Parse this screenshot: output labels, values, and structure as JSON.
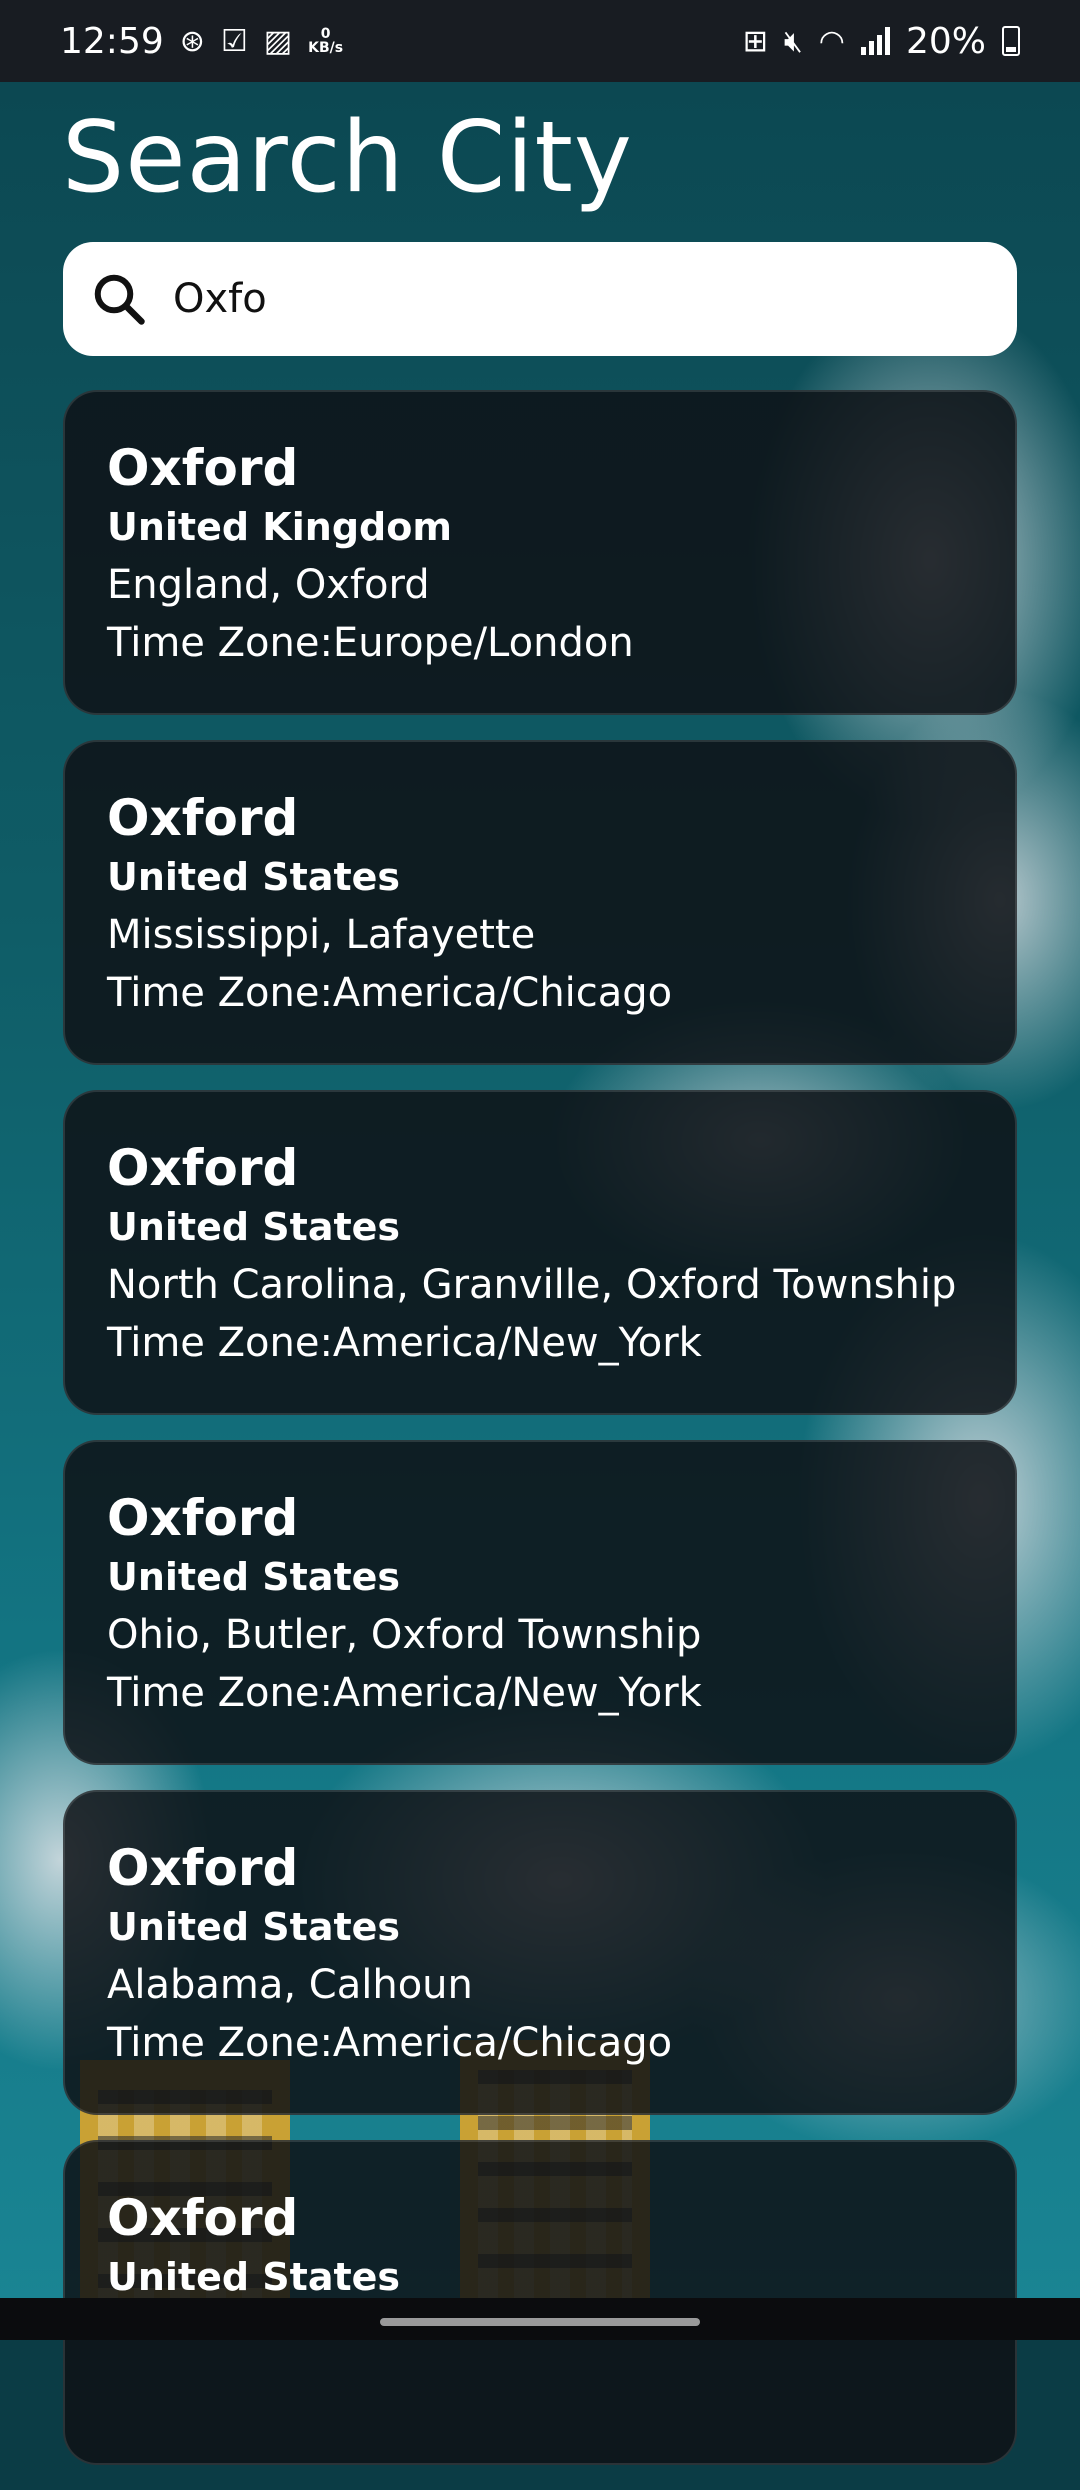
{
  "status": {
    "time": "12:59",
    "net_speed": "0",
    "net_unit": "KB/s",
    "battery": "20%"
  },
  "page": {
    "title": "Search City"
  },
  "search": {
    "value": "Oxfo",
    "icon": "search-icon"
  },
  "results": [
    {
      "city": "Oxford",
      "country": "United Kingdom",
      "region": "England, Oxford",
      "timezone": "Time Zone:Europe/London"
    },
    {
      "city": "Oxford",
      "country": "United States",
      "region": "Mississippi, Lafayette",
      "timezone": "Time Zone:America/Chicago"
    },
    {
      "city": "Oxford",
      "country": "United States",
      "region": "North Carolina, Granville, Oxford Township",
      "timezone": "Time Zone:America/New_York"
    },
    {
      "city": "Oxford",
      "country": "United States",
      "region": "Ohio, Butler, Oxford Township",
      "timezone": "Time Zone:America/New_York"
    },
    {
      "city": "Oxford",
      "country": "United States",
      "region": "Alabama, Calhoun",
      "timezone": "Time Zone:America/Chicago"
    },
    {
      "city": "Oxford",
      "country": "United States",
      "region": "",
      "timezone": ""
    }
  ]
}
